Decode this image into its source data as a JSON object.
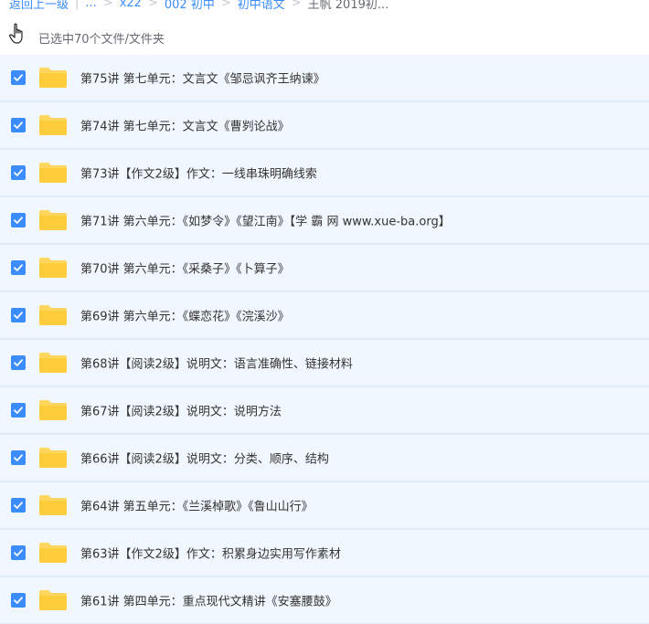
{
  "breadcrumb": {
    "back": "返回上一级",
    "ellipsis": "...",
    "items": [
      "x22",
      "002 初中",
      "初中语文"
    ],
    "current": "王帆 2019初..."
  },
  "selection": {
    "text": "已选中70个文件/文件夹"
  },
  "colors": {
    "accent": "#3b8cff",
    "row_selected_bg": "#f1f7fe",
    "folder": "#ffd75e"
  },
  "files": [
    {
      "name": "第75讲 第七单元：文言文《邹忌讽齐王纳谏》",
      "checked": true
    },
    {
      "name": "第74讲 第七单元：文言文《曹刿论战》",
      "checked": true
    },
    {
      "name": "第73讲【作文2级】作文：一线串珠明确线索",
      "checked": true
    },
    {
      "name": "第71讲 第六单元：《如梦令》《望江南》【学 霸 网 www.xue-ba.org】",
      "checked": true
    },
    {
      "name": "第70讲 第六单元：《采桑子》《卜算子》",
      "checked": true
    },
    {
      "name": "第69讲 第六单元：《蝶恋花》《浣溪沙》",
      "checked": true
    },
    {
      "name": "第68讲【阅读2级】说明文：语言准确性、链接材料",
      "checked": true
    },
    {
      "name": "第67讲【阅读2级】说明文：说明方法",
      "checked": true
    },
    {
      "name": "第66讲【阅读2级】说明文：分类、顺序、结构",
      "checked": true
    },
    {
      "name": "第64讲 第五单元：《兰溪棹歌》《鲁山山行》",
      "checked": true
    },
    {
      "name": "第63讲【作文2级】作文：积累身边实用写作素材",
      "checked": true
    },
    {
      "name": "第61讲 第四单元：重点现代文精讲《安塞腰鼓》",
      "checked": true
    }
  ]
}
